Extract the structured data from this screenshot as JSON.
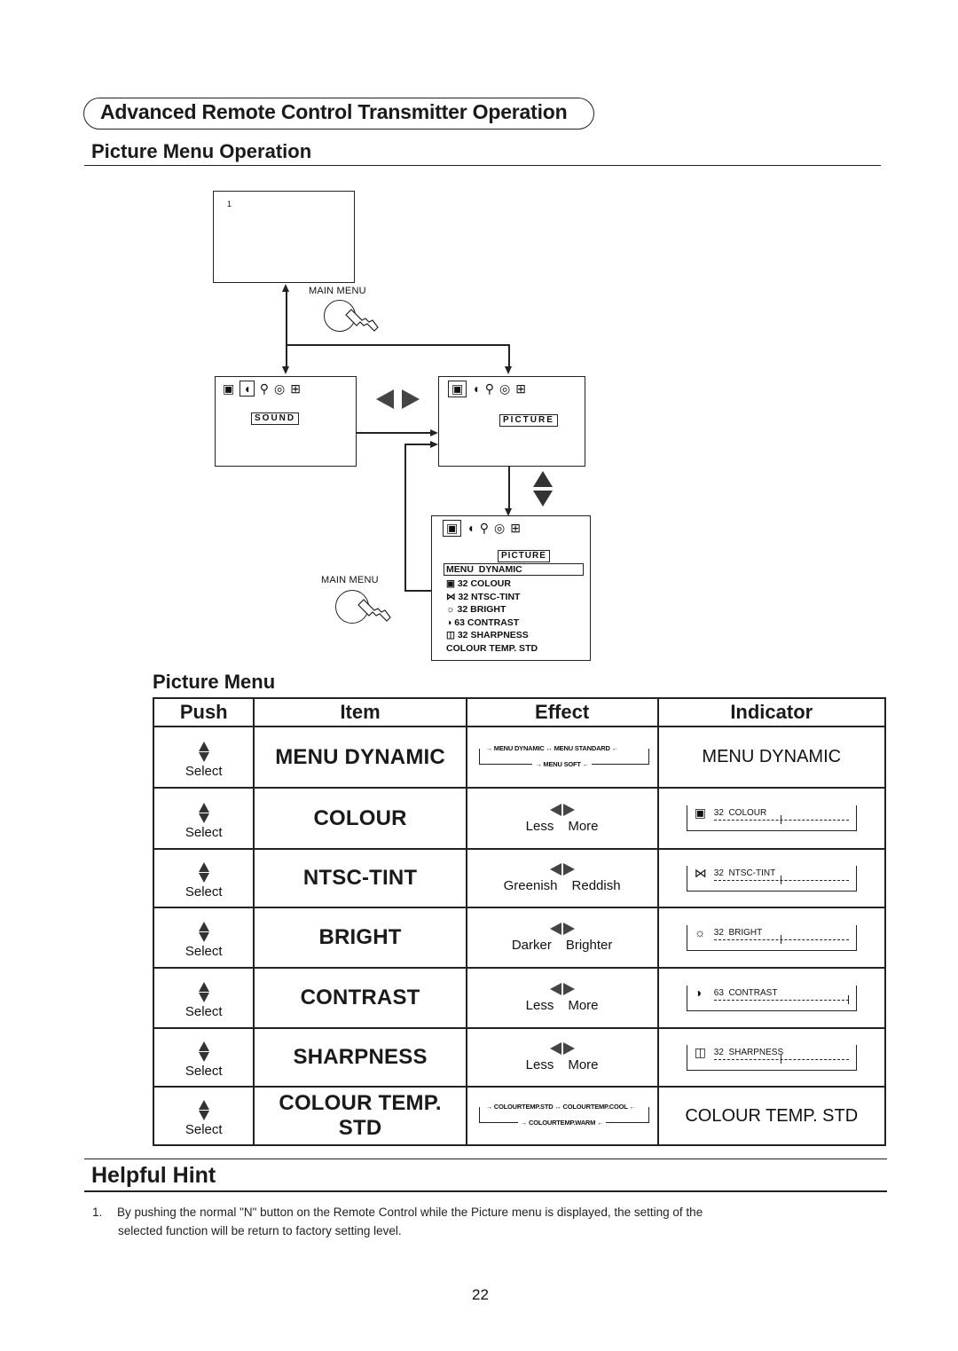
{
  "header": {
    "section_title": "Advanced Remote Control Transmitter Operation",
    "subheading": "Picture Menu Operation"
  },
  "diagram": {
    "screen1": {
      "channel_number": "1"
    },
    "main_menu_label_top": "MAIN MENU",
    "main_menu_label_bottom": "MAIN MENU",
    "sound_screen": {
      "icons": [
        "picture-icon",
        "sound-icon",
        "setup-icon",
        "timer-icon",
        "lock-icon"
      ],
      "tag": "SOUND"
    },
    "picture_screen": {
      "icons": [
        "picture-icon",
        "sound-icon",
        "setup-icon",
        "timer-icon",
        "lock-icon"
      ],
      "tag": "PICTURE"
    },
    "picture_menu_screen": {
      "icons": [
        "picture-icon",
        "sound-icon",
        "setup-icon",
        "timer-icon",
        "lock-icon"
      ],
      "tag": "PICTURE",
      "selected": "MENU  DYNAMIC",
      "items": [
        {
          "icon": "colour-icon",
          "glyph": "▣",
          "value": "32",
          "label": "COLOUR"
        },
        {
          "icon": "tint-icon",
          "glyph": "⋈",
          "value": "32",
          "label": "NTSC-TINT"
        },
        {
          "icon": "bright-icon",
          "glyph": "☼",
          "value": "32",
          "label": "BRIGHT"
        },
        {
          "icon": "contrast-icon",
          "glyph": "◑",
          "value": "63",
          "label": "CONTRAST"
        },
        {
          "icon": "sharpness-icon",
          "glyph": "◫",
          "value": "32",
          "label": "SHARPNESS"
        }
      ],
      "footer": "COLOUR TEMP. STD"
    }
  },
  "picture_menu": {
    "heading": "Picture Menu",
    "columns": [
      "Push",
      "Item",
      "Effect",
      "Indicator"
    ],
    "rows": [
      {
        "push": "Select",
        "item": "MENU DYNAMIC",
        "effect_type": "cycle",
        "effect_cycle": {
          "a": "MENU DYNAMIC",
          "b": "MENU STANDARD",
          "c": "MENU SOFT"
        },
        "indicator_type": "text",
        "indicator_text": "MENU DYNAMIC"
      },
      {
        "push": "Select",
        "item": "COLOUR",
        "effect_left": "Less",
        "effect_right": "More",
        "indicator_icon": "colour-icon",
        "indicator_glyph": "▣",
        "indicator_value": "32",
        "indicator_label": "COLOUR",
        "indicator_level": 0.5
      },
      {
        "push": "Select",
        "item": "NTSC-TINT",
        "effect_left": "Greenish",
        "effect_right": "Reddish",
        "indicator_icon": "tint-icon",
        "indicator_glyph": "⋈",
        "indicator_value": "32",
        "indicator_label": "NTSC-TINT",
        "indicator_level": 0.5
      },
      {
        "push": "Select",
        "item": "BRIGHT",
        "effect_left": "Darker",
        "effect_right": "Brighter",
        "indicator_icon": "bright-icon",
        "indicator_glyph": "☼",
        "indicator_value": "32",
        "indicator_label": "BRIGHT",
        "indicator_level": 0.5
      },
      {
        "push": "Select",
        "item": "CONTRAST",
        "effect_left": "Less",
        "effect_right": "More",
        "indicator_icon": "contrast-icon",
        "indicator_glyph": "◑",
        "indicator_value": "63",
        "indicator_label": "CONTRAST",
        "indicator_level": 1.0
      },
      {
        "push": "Select",
        "item": "SHARPNESS",
        "effect_left": "Less",
        "effect_right": "More",
        "indicator_icon": "sharpness-icon",
        "indicator_glyph": "◫",
        "indicator_value": "32",
        "indicator_label": "SHARPNESS",
        "indicator_level": 0.5
      },
      {
        "push": "Select",
        "item": "COLOUR TEMP. STD",
        "effect_type": "cycle",
        "effect_cycle": {
          "a": "COLOURTEMP.STD",
          "b": "COLOURTEMP.COOL",
          "c": "COLOURTEMP.WARM"
        },
        "indicator_type": "text",
        "indicator_text": "COLOUR TEMP. STD"
      }
    ]
  },
  "hint": {
    "title": "Helpful Hint",
    "items": [
      {
        "num": "1.",
        "line1": "By pushing the normal \"N\" button on the Remote Control while the Picture menu is displayed, the setting of the",
        "line2": "selected function will be return to factory setting level."
      }
    ]
  },
  "page_number": "22"
}
